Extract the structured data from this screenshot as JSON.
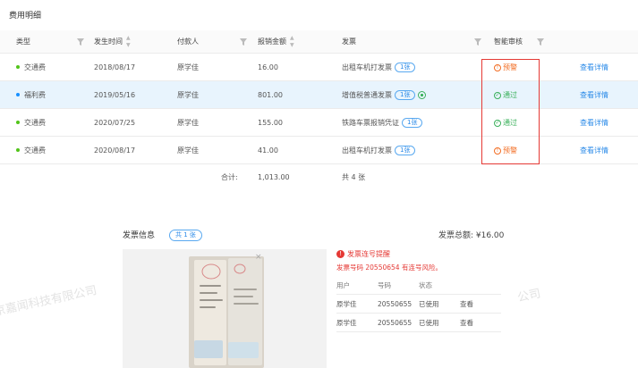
{
  "section_title": "费用明细",
  "columns": {
    "type": "类型",
    "time": "发生时间",
    "payer": "付款人",
    "amount": "报销金额",
    "invoice": "发票",
    "review": "智能审核"
  },
  "rows": [
    {
      "type": "交通费",
      "dot_color": "#52c41a",
      "time": "2018/08/17",
      "payer": "原学佳",
      "amount": "16.00",
      "invoice": "出租车机打发票",
      "tag": "1张",
      "extra_icon": false,
      "status": "预警",
      "status_kind": "warn",
      "action": "查看详情",
      "selected": false
    },
    {
      "type": "福利费",
      "dot_color": "#1890ff",
      "time": "2019/05/16",
      "payer": "原学佳",
      "amount": "801.00",
      "invoice": "增值税普通发票",
      "tag": "1张",
      "extra_icon": true,
      "status": "通过",
      "status_kind": "pass",
      "action": "查看详情",
      "selected": true
    },
    {
      "type": "交通费",
      "dot_color": "#52c41a",
      "time": "2020/07/25",
      "payer": "原学佳",
      "amount": "155.00",
      "invoice": "铁路车票报销凭证",
      "tag": "1张",
      "extra_icon": false,
      "status": "通过",
      "status_kind": "pass",
      "action": "查看详情",
      "selected": false
    },
    {
      "type": "交通费",
      "dot_color": "#52c41a",
      "time": "2020/08/17",
      "payer": "原学佳",
      "amount": "41.00",
      "invoice": "出租车机打发票",
      "tag": "1张",
      "extra_icon": false,
      "status": "预警",
      "status_kind": "warn",
      "action": "查看详情",
      "selected": false
    }
  ],
  "footer": {
    "label": "合计:",
    "amount": "1,013.00",
    "count": "共 4 张"
  },
  "invoice_info": {
    "title": "发票信息",
    "count_tag": "共 1 张",
    "total": "发票总额: ¥16.00",
    "alert_title": "发票连号提醒",
    "alert_desc": "发票号码 20550654 有连号风险。",
    "sub_columns": {
      "user": "用户",
      "number": "号码",
      "status": "状态"
    },
    "sub_rows": [
      {
        "user": "原学佳",
        "number": "20550655",
        "status": "已使用",
        "action": "查看"
      },
      {
        "user": "原学佳",
        "number": "20550655",
        "status": "已使用",
        "action": "查看"
      }
    ]
  },
  "watermarks": [
    "京嘉闻科技有限公司",
    "公司"
  ],
  "colors": {
    "accent": "#2a8ae8",
    "warn": "#f26c21",
    "pass": "#3ab05b",
    "alert": "#e53935",
    "selected_row": "#e8f4fd"
  },
  "icons": [
    "filter-icon",
    "sort-icon",
    "warning-icon",
    "check-circle-icon",
    "invoice-stamp-icon",
    "close-icon",
    "alert-icon"
  ]
}
